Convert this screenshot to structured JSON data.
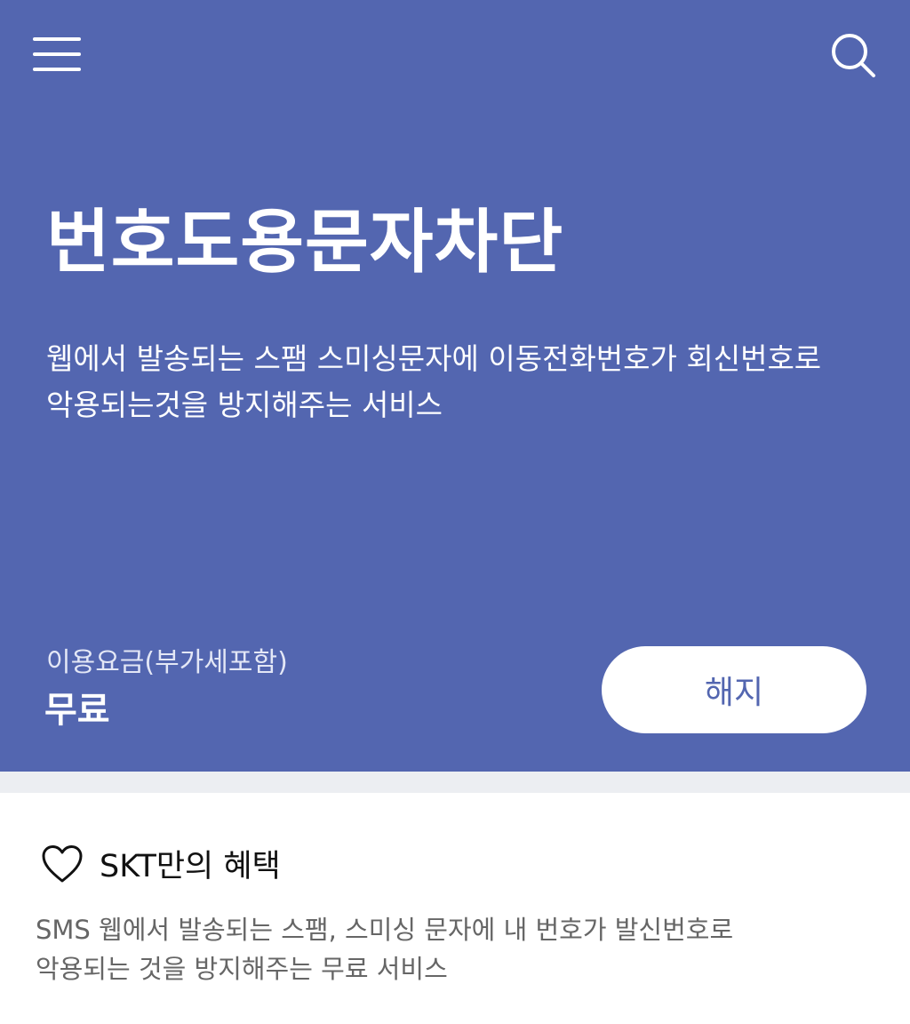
{
  "header": {
    "menu_icon": "hamburger-menu-icon",
    "search_icon": "search-icon"
  },
  "hero": {
    "title": "번호도용문자차단",
    "description_line1": "웹에서 발송되는 스팸 스미싱문자에 이동전화번호가 회신번호로",
    "description_line2": "악용되는것을 방지해주는 서비스",
    "fee_label": "이용요금(부가세포함)",
    "fee_value": "무료",
    "cancel_label": "해지",
    "background_color": "#5366b0"
  },
  "benefit": {
    "icon": "heart-icon",
    "title": "SKT만의 혜택",
    "description_line1": "SMS 웹에서 발송되는 스팸, 스미싱 문자에 내 번호가 발신번호로",
    "description_line2": "악용되는 것을 방지해주는 무료 서비스"
  }
}
